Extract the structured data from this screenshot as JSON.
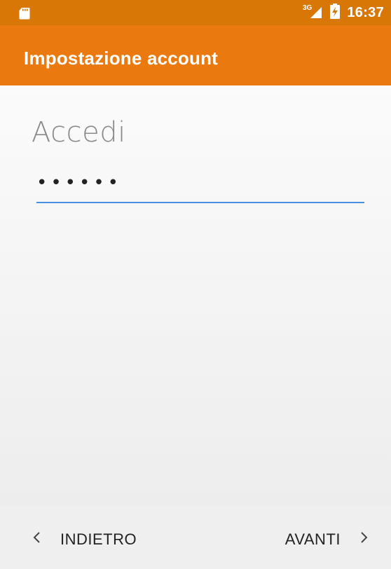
{
  "status_bar": {
    "time": "16:37",
    "network": "3G",
    "icons": [
      "sd-card-icon",
      "signal-icon",
      "battery-charging-icon"
    ]
  },
  "app_bar": {
    "title": "Impostazione account"
  },
  "main": {
    "heading": "Accedi",
    "password_value": "••••••"
  },
  "nav": {
    "back_label": "INDIETRO",
    "next_label": "AVANTI",
    "back_icon": "chevron-left-icon",
    "next_icon": "chevron-right-icon"
  },
  "colors": {
    "status_bar": "#d97706",
    "app_bar": "#ea7a0f",
    "field_underline": "#4a90e2"
  }
}
